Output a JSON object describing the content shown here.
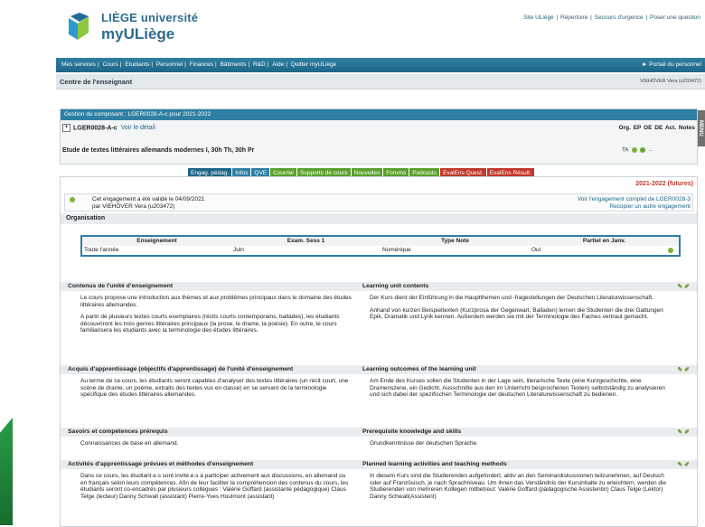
{
  "header": {
    "brand_line1": "LIÈGE université",
    "brand_line2": "myULiège",
    "top_links": [
      "Site ULiège",
      "Répertoire",
      "Secours d'urgence",
      "Poser une question"
    ]
  },
  "nav": {
    "items": [
      "Mes services",
      "Cours",
      "Etudiants",
      "Personnel",
      "Finances",
      "Bâtiments",
      "R&D",
      "Aide",
      "Quitter myULiège"
    ],
    "portal": "► Portail du personnel"
  },
  "subbar": {
    "title": "Centre de l'enseignant",
    "user": "VIEHÖVER Vera (u203472)"
  },
  "menu_tab": "MENU",
  "component": {
    "header": "Gestion du composant : LGER0028-A-c pour 2021-2022",
    "code": "LGER0028-A-c",
    "detail_link": "Voir le détail",
    "columns": "Org.  EP  OE  DE   Act.  Notes",
    "course": "Etude de textes littéraires allemands modernes I, 30h Th, 30h Pr",
    "status": "TA"
  },
  "tabs": [
    {
      "label": "Engag. pédag.",
      "color": "#1d6688"
    },
    {
      "label": "Infos",
      "color": "#2e7fa3"
    },
    {
      "label": "QVE",
      "color": "#2e7fa3"
    },
    {
      "label": "Courriel",
      "color": "#5aa02c"
    },
    {
      "label": "Supports de cours",
      "color": "#5aa02c"
    },
    {
      "label": "Nouvelles",
      "color": "#5aa02c"
    },
    {
      "label": "Forums",
      "color": "#5aa02c"
    },
    {
      "label": "Podcasts",
      "color": "#5aa02c"
    },
    {
      "label": "EvalEns Quest.",
      "color": "#c0392b"
    },
    {
      "label": "EvalEns Résult.",
      "color": "#c0392b"
    }
  ],
  "year_label": "2021-2022 (futures)",
  "validation": {
    "line1": "Cet engagement a été validé le 04/09/2021",
    "line2": "par VIEHÖVER Vera (u203472)",
    "link1": "Voir l'engagement complet de LGER0028-3",
    "link2": "Recopier un autre engagement"
  },
  "organisation": {
    "title": "Organisation",
    "headers": [
      "Enseignement",
      "Exam. Sess 1",
      "Type Note",
      "Partiel en Janv."
    ],
    "row": [
      "Toute l'année",
      "Juin",
      "Numérique",
      "Oui"
    ]
  },
  "sections": [
    {
      "fr_title": "Contenus de l'unité d'enseignement",
      "en_title": "Learning unit contents",
      "fr": [
        "Le cours propose une introduction aux thèmes et aux problèmes principaux dans le domaine des études littéraires allemandes.",
        "A partir de plusieurs textes courts exemplaires (récits courts contemporains, ballades), les étudiants découvriront les trois genres littéraires principaux (la prose, le drame, la poésie). En outre, le cours familiarisera les étudiants avec la terminologie des études littéraires."
      ],
      "en": [
        "Der Kurs dient der Einführung in die Hauptthemen und -fragestellungen der Deutschen Literaturwissenschaft.",
        "Anhand von kurzen Beispieltexten (Kurzprosa der Gegenwart, Balladen) lernen die Studenten die drei Gattungen Epik, Dramatik und Lyrik kennen. Außerdem werden sie mit der Terminologie des Faches vertraut gemacht."
      ]
    },
    {
      "fr_title": "Acquis d'apprentissage (objectifs d'apprentissage) de l'unité d'enseignement",
      "en_title": "Learning outcomes of the learning unit",
      "fr": [
        "Au terme de ce cours, les étudiants seront capables d'analyser des textes littéraires (un récit court, une scène de drame, un poème, extraits des textes vus en classe) en se servant de la terminologie spécifique des études littéraires allemandes."
      ],
      "en": [
        "Am Ende des Kurses sollen die Studenten in der Lage sein, literarische Texte (eine Kurzgeschichte, eine Dramenszene, ein Gedicht, Ausschnitte aus den im Unterricht besprochenen Texten) selbstständig zu analysieren und sich dabei der spezifischen Terminologie der deutschen Literaturwissenschaft zu bedienen."
      ]
    },
    {
      "fr_title": "Savoirs et compétences prérequis",
      "en_title": "Prerequisite knowledge and skills",
      "fr": [
        "Connaissances de base en allemand."
      ],
      "en": [
        "Grundkenntnisse der deutschen Sprache."
      ]
    },
    {
      "fr_title": "Activités d'apprentissage prévues et méthodes d'enseignement",
      "en_title": "Planned learning activities and teaching methods",
      "fr": [
        "Dans ce cours, les étudiant.e.s sont invité.e.s à participer activement aux discussions, en allemand ou en français selon leurs compétences. Afin de leur faciliter la compréhension des contenus du cours, les étudiants seront co-encadrés par plusieurs collègues : Valérie Goffard (assistante pédagogique) Claus Telge (lecteur) Danny Schwall (assistant) Pierre-Yves Houlmont (assistant)"
      ],
      "en": [
        "In diesem Kurs sind die Studierenden aufgefordert, aktiv an den Seminardiskussionen teilzunehmen, auf Deutsch oder auf Französisch, je nach Sprachniveau. Um ihnen das Verständnis der Kursinhalte zu erleichtern, werden die Studierenden von mehreren Kollegen mitbetreut: Valérie Goffard (pädagogische Assistentin) Claus Telge (Lektor) Danny Schwall(Assistent)"
      ]
    }
  ],
  "colors": {
    "nav": "#2e7fa3",
    "brand": "#2c6d8c",
    "alert": "#c0392b",
    "ok": "#7ab33a"
  }
}
